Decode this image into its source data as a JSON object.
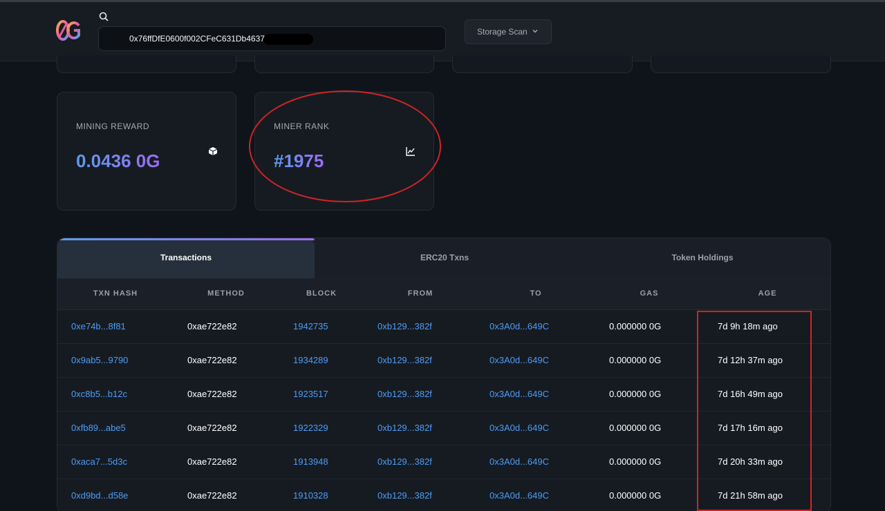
{
  "header": {
    "search_value": "0x76ffDfE0600f002CFeC631Db4637/",
    "storage_label": "Storage Scan"
  },
  "cards": [
    {
      "label": "MINING REWARD",
      "value": "0.0436 0G",
      "icon": "cube-icon"
    },
    {
      "label": "MINER RANK",
      "value": "#1975",
      "icon": "chart-line-icon"
    }
  ],
  "tabs": [
    {
      "label": "Transactions",
      "active": true
    },
    {
      "label": "ERC20 Txns",
      "active": false
    },
    {
      "label": "Token Holdings",
      "active": false
    }
  ],
  "table": {
    "headers": [
      "TXN HASH",
      "METHOD",
      "BLOCK",
      "FROM",
      "TO",
      "GAS",
      "AGE"
    ],
    "rows": [
      [
        "0xe74b...8f81",
        "0xae722e82",
        "1942735",
        "0xb129...382f",
        "0x3A0d...649C",
        "0.000000 0G",
        "7d 9h 18m ago"
      ],
      [
        "0x9ab5...9790",
        "0xae722e82",
        "1934289",
        "0xb129...382f",
        "0x3A0d...649C",
        "0.000000 0G",
        "7d 12h 37m ago"
      ],
      [
        "0xc8b5...b12c",
        "0xae722e82",
        "1923517",
        "0xb129...382f",
        "0x3A0d...649C",
        "0.000000 0G",
        "7d 16h 49m ago"
      ],
      [
        "0xfb89...abe5",
        "0xae722e82",
        "1922329",
        "0xb129...382f",
        "0x3A0d...649C",
        "0.000000 0G",
        "7d 17h 16m ago"
      ],
      [
        "0xaca7...5d3c",
        "0xae722e82",
        "1913948",
        "0xb129...382f",
        "0x3A0d...649C",
        "0.000000 0G",
        "7d 20h 33m ago"
      ],
      [
        "0xd9bd...d58e",
        "0xae722e82",
        "1910328",
        "0xb129...382f",
        "0x3A0d...649C",
        "0.000000 0G",
        "7d 21h 58m ago"
      ]
    ]
  },
  "colors": {
    "accent_blue": "#4f9cf5",
    "accent_purple": "#9b6cf0",
    "annotation_red": "#d02424"
  }
}
